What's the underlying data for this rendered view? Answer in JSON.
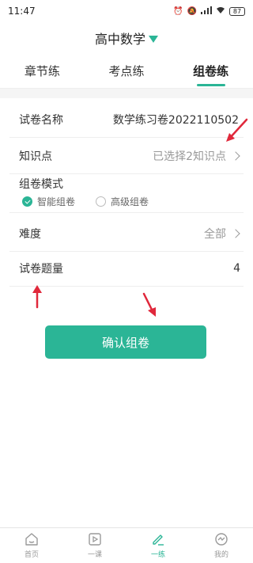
{
  "status_bar": {
    "time": "11:47",
    "battery": "87"
  },
  "header": {
    "title": "高中数学"
  },
  "tabs": [
    {
      "label": "章节练",
      "active": false
    },
    {
      "label": "考点练",
      "active": false
    },
    {
      "label": "组卷练",
      "active": true
    }
  ],
  "form": {
    "paper_name_label": "试卷名称",
    "paper_name_value": "数学练习卷2022110502",
    "knowledge_label": "知识点",
    "knowledge_value": "已选择2知识点",
    "mode_label": "组卷模式",
    "mode_options": [
      "智能组卷",
      "高级组卷"
    ],
    "mode_selected": "智能组卷",
    "difficulty_label": "难度",
    "difficulty_value": "全部",
    "count_label": "试卷题量",
    "count_value": "4"
  },
  "confirm_button": "确认组卷",
  "bottom_nav": [
    {
      "label": "首页",
      "icon": "home-icon",
      "active": false
    },
    {
      "label": "一课",
      "icon": "video-icon",
      "active": false
    },
    {
      "label": "一练",
      "icon": "pencil-icon",
      "active": true
    },
    {
      "label": "我的",
      "icon": "profile-icon",
      "active": false
    }
  ],
  "colors": {
    "accent": "#2bb596",
    "annotation_arrow": "#e0283b"
  }
}
